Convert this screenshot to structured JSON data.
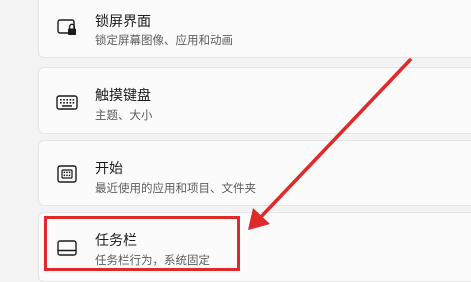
{
  "settings_items": [
    {
      "title": "锁屏界面",
      "subtitle": "锁定屏幕图像、应用和动画",
      "icon": "lock-screen-icon"
    },
    {
      "title": "触摸键盘",
      "subtitle": "主题、大小",
      "icon": "keyboard-icon"
    },
    {
      "title": "开始",
      "subtitle": "最近使用的应用和项目、文件夹",
      "icon": "start-icon"
    },
    {
      "title": "任务栏",
      "subtitle": "任务栏行为，系统固定",
      "icon": "taskbar-icon"
    }
  ],
  "annotation": {
    "color": "#e02a2a",
    "target": "任务栏"
  }
}
